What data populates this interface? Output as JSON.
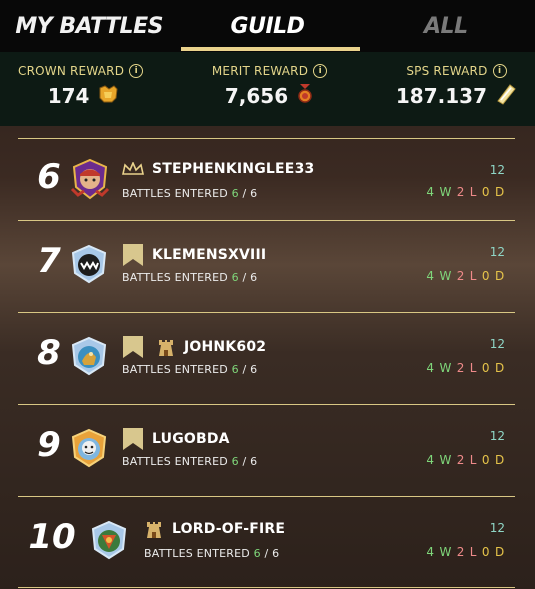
{
  "tabs": [
    {
      "label": "MY BATTLES"
    },
    {
      "label": "GUILD"
    },
    {
      "label": "ALL"
    }
  ],
  "active_tab": "GUILD",
  "rewards": [
    {
      "label": "CROWN REWARD",
      "value": "174",
      "icon": "crown-token-icon"
    },
    {
      "label": "MERIT REWARD",
      "value": "7,656",
      "icon": "merit-medal-icon"
    },
    {
      "label": "SPS REWARD",
      "value": "187.137",
      "icon": "sps-token-icon"
    }
  ],
  "battles_label": "BATTLES ENTERED",
  "players": [
    {
      "rank": "6",
      "name": "STEPHENKINGLEE33",
      "role": "crown-icon",
      "done": "6",
      "total": "6",
      "score": "12",
      "w": "4 W",
      "l": "2 L",
      "d": "0 D"
    },
    {
      "rank": "7",
      "name": "KLEMENSXVIII",
      "role": "banner-icon",
      "done": "6",
      "total": "6",
      "score": "12",
      "w": "4 W",
      "l": "2 L",
      "d": "0 D"
    },
    {
      "rank": "8",
      "name": "JOHNK602",
      "role": "banner-icon",
      "extra": "tower-icon",
      "done": "6",
      "total": "6",
      "score": "12",
      "w": "4 W",
      "l": "2 L",
      "d": "0 D"
    },
    {
      "rank": "9",
      "name": "LUGOBDA",
      "role": "banner-icon",
      "done": "6",
      "total": "6",
      "score": "12",
      "w": "4 W",
      "l": "2 L",
      "d": "0 D"
    },
    {
      "rank": "10",
      "name": "LORD-OF-FIRE",
      "role": "tower-icon",
      "done": "6",
      "total": "6",
      "score": "12",
      "w": "4 W",
      "l": "2 L",
      "d": "0 D"
    }
  ],
  "colors": {
    "accent": "#e9d28c",
    "win": "#7fd67a",
    "loss": "#ef8a8a",
    "draw": "#e6c44a",
    "score": "#8fd6c6"
  }
}
